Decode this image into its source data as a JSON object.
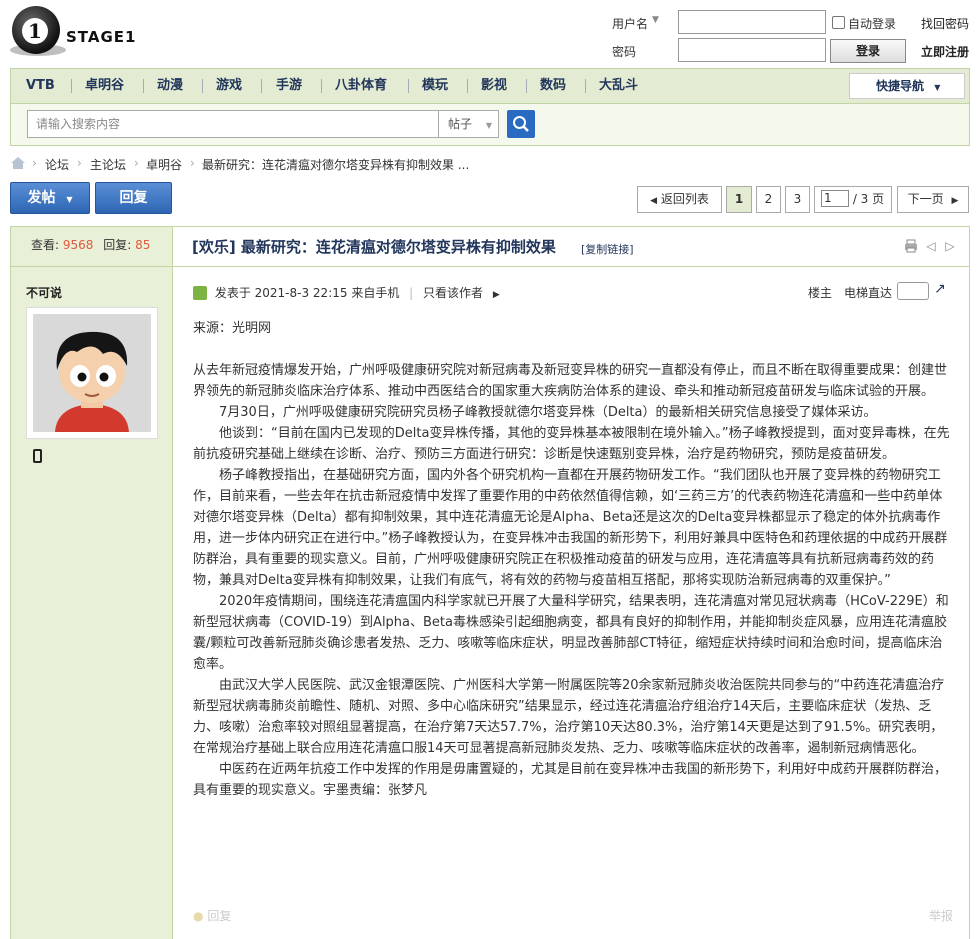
{
  "logo": {
    "text": "STAGE1",
    "mark": "1"
  },
  "login": {
    "username_label": "用户名",
    "password_label": "密码",
    "auto_login_label": "自动登录",
    "login_button": "登录",
    "find_password": "找回密码",
    "register": "立即注册"
  },
  "nav": {
    "items": [
      "VTB",
      "卓明谷",
      "动漫",
      "游戏",
      "手游",
      "八卦体育",
      "模玩",
      "影视",
      "数码",
      "大乱斗"
    ],
    "quick_nav": "快捷导航"
  },
  "search": {
    "placeholder": "请输入搜索内容",
    "type": "帖子"
  },
  "breadcrumb": [
    "论坛",
    "主论坛",
    "卓明谷",
    "最新研究：连花清瘟对德尔塔变异株有抑制效果 ..."
  ],
  "actions": {
    "post": "发帖",
    "reply": "回复",
    "back": "返回列表",
    "pages": [
      "1",
      "2",
      "3"
    ],
    "page_input": "1",
    "page_total": "/ 3 页",
    "next": "下一页"
  },
  "thread": {
    "views_label": "查看:",
    "views": "9568",
    "replies_label": "回复:",
    "replies": "85",
    "title": "[欢乐] 最新研究：连花清瘟对德尔塔变异株有抑制效果",
    "copy_link": "[复制链接]"
  },
  "post": {
    "author": "不可说",
    "posted": "发表于 2021-8-3 22:15 来自手机",
    "only_author": "只看该作者",
    "floor_label": "楼主",
    "elevator_label": "电梯直达",
    "source": "来源：光明网",
    "paragraphs": [
      "从去年新冠疫情爆发开始，广州呼吸健康研究院对新冠病毒及新冠变异株的研究一直都没有停止，而且不断在取得重要成果：创建世界领先的新冠肺炎临床治疗体系、推动中西医结合的国家重大疾病防治体系的建设、牵头和推动新冠疫苗研发与临床试验的开展。",
      "7月30日，广州呼吸健康研究院研究员杨子峰教授就德尔塔变异株（Delta）的最新相关研究信息接受了媒体采访。",
      "他谈到：“目前在国内已发现的Delta变异株传播，其他的变异株基本被限制在境外输入。”杨子峰教授提到，面对变异毒株，在先前抗疫研究基础上继续在诊断、治疗、预防三方面进行研究：诊断是快速甄别变异株，治疗是药物研究，预防是疫苗研发。",
      "杨子峰教授指出，在基础研究方面，国内外各个研究机构一直都在开展药物研发工作。“我们团队也开展了变异株的药物研究工作，目前来看，一些去年在抗击新冠疫情中发挥了重要作用的中药依然值得信赖，如‘三药三方’的代表药物连花清瘟和一些中药单体对德尔塔变异株（Delta）都有抑制效果，其中连花清瘟无论是Alpha、Beta还是这次的Delta变异株都显示了稳定的体外抗病毒作用，进一步体内研究正在进行中。”杨子峰教授认为，在变异株冲击我国的新形势下，利用好兼具中医特色和药理依据的中成药开展群防群治，具有重要的现实意义。目前，广州呼吸健康研究院正在积极推动疫苗的研发与应用，连花清瘟等具有抗新冠病毒药效的药物，兼具对Delta变异株有抑制效果，让我们有底气，将有效的药物与疫苗相互搭配，那将实现防治新冠病毒的双重保护。”",
      "2020年疫情期间，围绕连花清瘟国内科学家就已开展了大量科学研究，结果表明，连花清瘟对常见冠状病毒（HCoV-229E）和新型冠状病毒（COVID-19）到Alpha、Beta毒株感染引起细胞病变，都具有良好的抑制作用，并能抑制炎症风暴，应用连花清瘟胶囊/颗粒可改善新冠肺炎确诊患者发热、乏力、咳嗽等临床症状，明显改善肺部CT特征，缩短症状持续时间和治愈时间，提高临床治愈率。",
      "由武汉大学人民医院、武汉金银潭医院、广州医科大学第一附属医院等20余家新冠肺炎收治医院共同参与的“中药连花清瘟治疗新型冠状病毒肺炎前瞻性、随机、对照、多中心临床研究”结果显示，经过连花清瘟治疗组治疗14天后，主要临床症状（发热、乏力、咳嗽）治愈率较对照组显著提高，在治疗第7天达57.7%，治疗第10天达80.3%，治疗第14天更是达到了91.5%。研究表明，在常规治疗基础上联合应用连花清瘟口服14天可显著提高新冠肺炎发热、乏力、咳嗽等临床症状的改善率，遏制新冠病情恶化。",
      "中医药在近两年抗疫工作中发挥的作用是毋庸置疑的，尤其是目前在变异株冲击我国的新形势下，利用好中成药开展群防群治，具有重要的现实意义。宇墨责编：张梦凡"
    ],
    "reply_link": "回复",
    "report_link": "举报"
  }
}
